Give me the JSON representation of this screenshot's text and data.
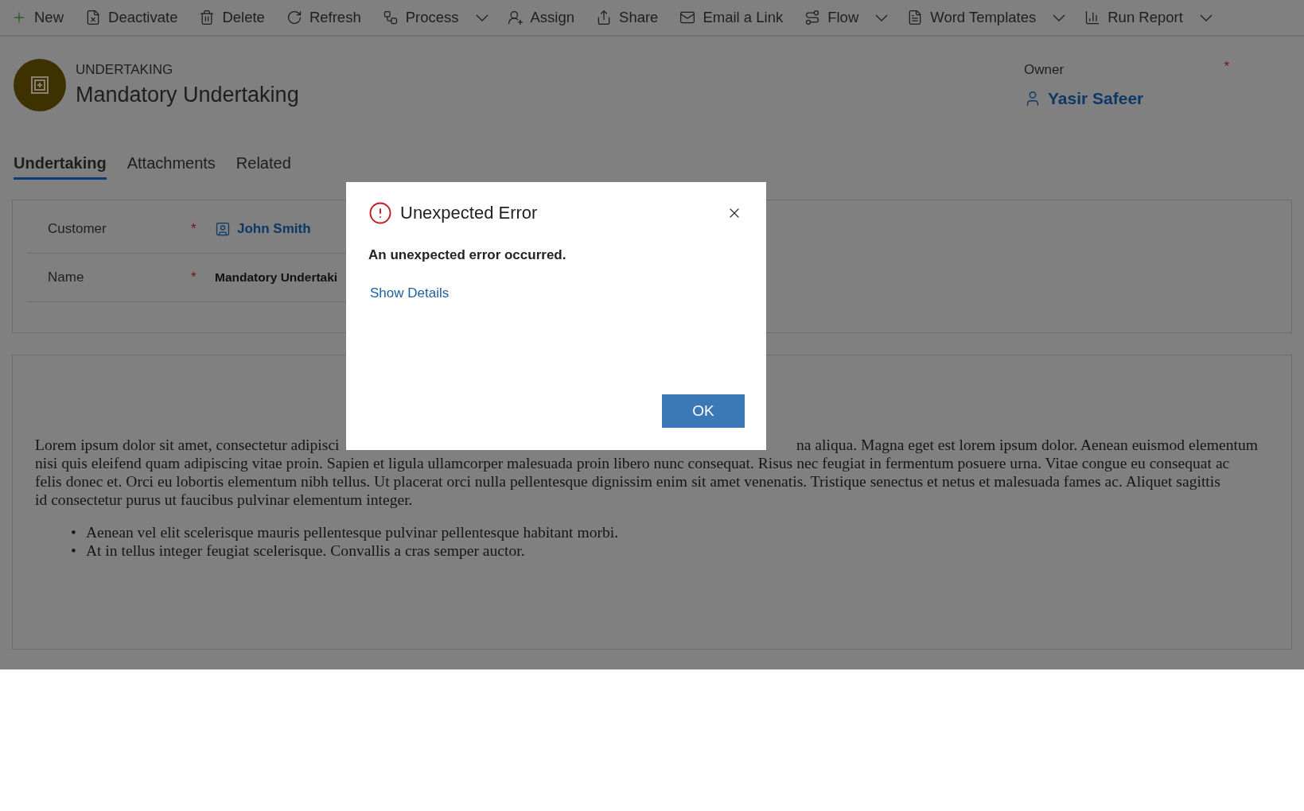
{
  "toolbar": [
    {
      "kind": "new",
      "label": "New",
      "has_menu": false
    },
    {
      "kind": "deactivate",
      "label": "Deactivate",
      "has_menu": false
    },
    {
      "kind": "delete",
      "label": "Delete",
      "has_menu": false
    },
    {
      "kind": "refresh",
      "label": "Refresh",
      "has_menu": false
    },
    {
      "kind": "process",
      "label": "Process",
      "has_menu": true
    },
    {
      "kind": "assign",
      "label": "Assign",
      "has_menu": false
    },
    {
      "kind": "share",
      "label": "Share",
      "has_menu": false
    },
    {
      "kind": "email",
      "label": "Email a Link",
      "has_menu": false
    },
    {
      "kind": "flow",
      "label": "Flow",
      "has_menu": true
    },
    {
      "kind": "word",
      "label": "Word Templates",
      "has_menu": true
    },
    {
      "kind": "report",
      "label": "Run Report",
      "has_menu": true
    }
  ],
  "record": {
    "entity": "UNDERTAKING",
    "title": "Mandatory Undertaking"
  },
  "owner": {
    "label": "Owner",
    "required_marker": "*",
    "value": "Yasir Safeer"
  },
  "tabs": [
    {
      "label": "Undertaking",
      "selected": true
    },
    {
      "label": "Attachments",
      "selected": false
    },
    {
      "label": "Related",
      "selected": false
    }
  ],
  "fields": [
    {
      "kind": "lookup",
      "label": "Customer",
      "required_marker": "*",
      "value": "John Smith"
    },
    {
      "kind": "text",
      "label": "Name",
      "required_marker": "*",
      "value": "Mandatory Undertaki"
    }
  ],
  "description": {
    "lines": [
      {
        "left": "Lorem ipsum dolor sit amet, consectetur adipisci",
        "right": "na aliqua. Magna eget est lorem ipsum dolor. Aenean euismod elementum"
      },
      {
        "left": "nisi quis eleifend quam adipiscing vitae proin. Sapien et ligula ullamcorper malesuada proin libero nunc consequat. Risus nec feugiat in fermentum posuere urna. Vitae congue eu consequat ac"
      },
      {
        "left": "felis donec et. Orci eu lobortis elementum nibh tellus. Ut placerat orci nulla pellentesque dignissim enim sit amet venenatis. Tristique senectus et netus et malesuada fames ac. Aliquet sagittis"
      },
      {
        "left": "id consectetur purus ut faucibus pulvinar elementum integer."
      }
    ],
    "bullets": [
      {
        "marker": "•",
        "text": "Aenean vel elit scelerisque mauris pellentesque pulvinar pellentesque habitant morbi."
      },
      {
        "marker": "•",
        "text": "At in tellus integer feugiat scelerisque. Convallis a cras semper auctor."
      }
    ]
  },
  "dialog": {
    "title": "Unexpected Error",
    "message": "An unexpected error occurred.",
    "link": "Show Details",
    "button": "OK"
  }
}
